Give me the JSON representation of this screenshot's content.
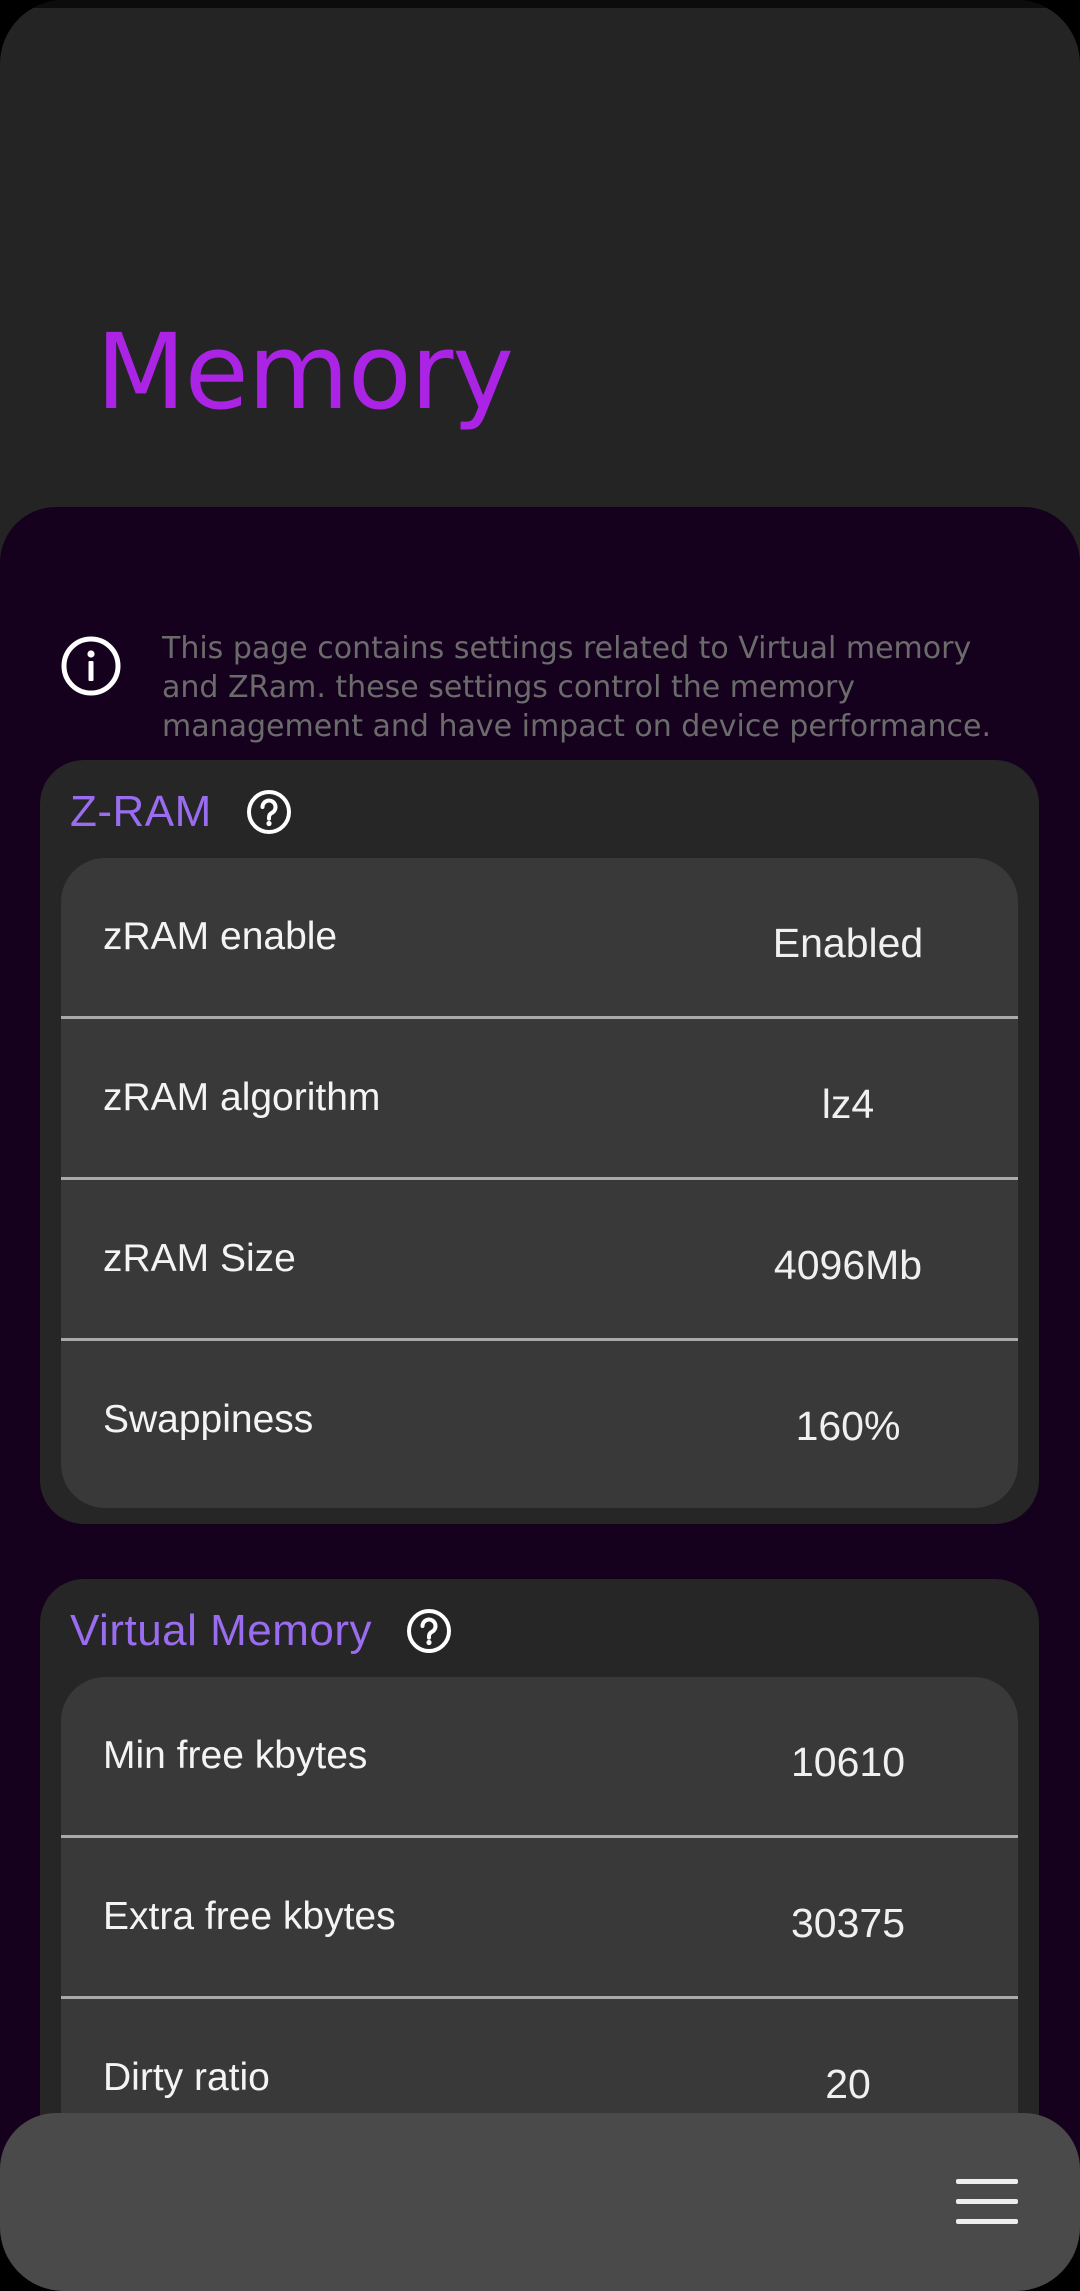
{
  "page": {
    "title": "Memory",
    "info_text": "This page contains settings related to Virtual memory and ZRam. these settings control the memory management and have impact on device performance."
  },
  "zram": {
    "title": "Z-RAM",
    "rows": [
      {
        "label": "zRAM enable",
        "value": "Enabled"
      },
      {
        "label": "zRAM algorithm",
        "value": "lz4"
      },
      {
        "label": "zRAM Size",
        "value": "4096Mb"
      },
      {
        "label": "Swappiness",
        "value": "160%"
      }
    ]
  },
  "virtual_memory": {
    "title": "Virtual Memory",
    "rows": [
      {
        "label": "Min free kbytes",
        "value": "10610"
      },
      {
        "label": "Extra free kbytes",
        "value": "30375"
      },
      {
        "label": "Dirty ratio",
        "value": "20"
      }
    ]
  },
  "icons": {
    "info": "info-icon",
    "help": "help-icon",
    "menu": "menu-icon"
  },
  "colors": {
    "title_accent": "#ab24e6",
    "section_title": "#9a6cf0",
    "content_background": "#15011d"
  }
}
